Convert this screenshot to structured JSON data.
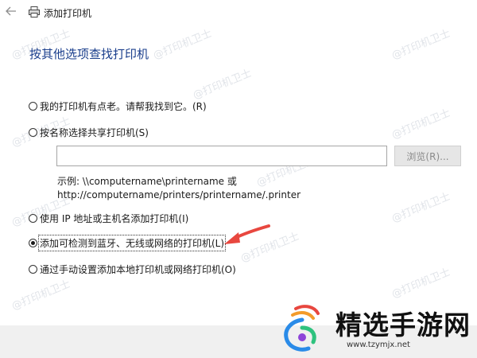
{
  "window": {
    "title": "添加打印机"
  },
  "heading": "按其他选项查找打印机",
  "options": [
    {
      "label": "我的打印机有点老。请帮我找到它。(R)",
      "checked": false
    },
    {
      "label": "按名称选择共享打印机(S)",
      "checked": false
    },
    {
      "label": "使用 IP 地址或主机名添加打印机(I)",
      "checked": false
    },
    {
      "label": "添加可检测到蓝牙、无线或网络的打印机(L)",
      "checked": true
    },
    {
      "label": "通过手动设置添加本地打印机或网络打印机(O)",
      "checked": false
    }
  ],
  "shared_input": {
    "value": ""
  },
  "browse_button": "浏览(R)...",
  "example": {
    "line1": "示例: \\\\computername\\printername 或",
    "line2": "http://computername/printers/printername/.printer"
  },
  "watermark_text": "@打印机卫士",
  "branding": {
    "name": "精选手游网",
    "url": "www.tzymjx.net"
  },
  "colors": {
    "heading": "#1a3e8c",
    "arrow": "#e8473f",
    "bottom_bar": "#f0f0f0"
  }
}
